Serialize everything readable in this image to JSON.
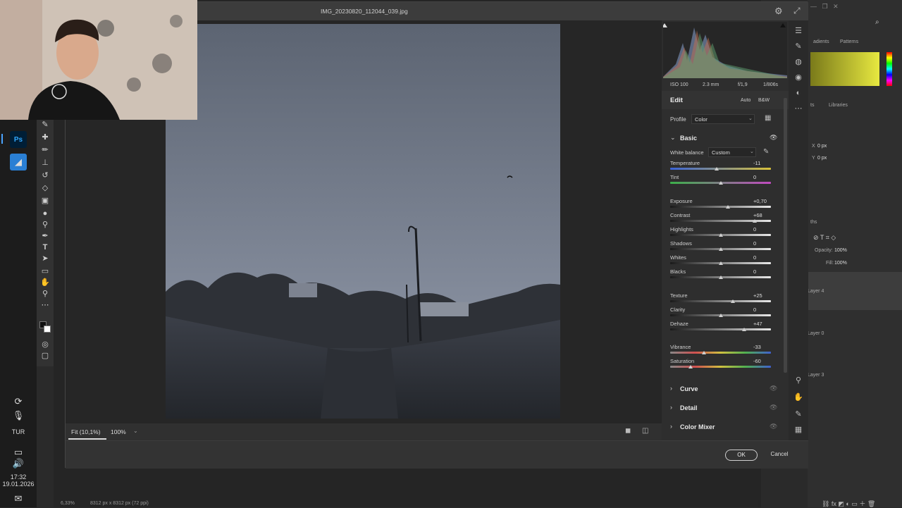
{
  "dialog": {
    "title": "IMG_20230820_112044_039.jpg",
    "exif": {
      "iso": "ISO 100",
      "focal": "2.3 mm",
      "aperture": "f/1,9",
      "shutter": "1/806s"
    },
    "edit": {
      "heading": "Edit",
      "auto": "Auto",
      "bw": "B&W"
    },
    "profile": {
      "label": "Profile",
      "value": "Color"
    },
    "basic": {
      "title": "Basic",
      "white_balance": {
        "label": "White balance",
        "value": "Custom"
      },
      "sliders": [
        {
          "label": "Temperature",
          "value": "-11",
          "pos": 0.46
        },
        {
          "label": "Tint",
          "value": "0",
          "pos": 0.5
        },
        {
          "label": "Exposure",
          "value": "+0,70",
          "pos": 0.57
        },
        {
          "label": "Contrast",
          "value": "+68",
          "pos": 0.84
        },
        {
          "label": "Highlights",
          "value": "0",
          "pos": 0.5
        },
        {
          "label": "Shadows",
          "value": "0",
          "pos": 0.5
        },
        {
          "label": "Whites",
          "value": "0",
          "pos": 0.5
        },
        {
          "label": "Blacks",
          "value": "0",
          "pos": 0.5
        },
        {
          "label": "Texture",
          "value": "+25",
          "pos": 0.625
        },
        {
          "label": "Clarity",
          "value": "0",
          "pos": 0.5
        },
        {
          "label": "Dehaze",
          "value": "+47",
          "pos": 0.735
        },
        {
          "label": "Vibrance",
          "value": "-33",
          "pos": 0.335
        },
        {
          "label": "Saturation",
          "value": "-60",
          "pos": 0.2
        }
      ]
    },
    "sections": [
      "Curve",
      "Detail",
      "Color Mixer"
    ],
    "zoom": {
      "fit": "Fit (10,1%)",
      "percent": "100%"
    },
    "ok": "OK",
    "cancel": "Cancel"
  },
  "ps": {
    "panel_tabs": {
      "gradients": "adients",
      "patterns": "Patterns",
      "libraries": "Libraries",
      "ts": "ts",
      "ths": "ths"
    },
    "props": {
      "x": "0 px",
      "y": "0 px"
    },
    "layers": {
      "opacity_label": "Opacity:",
      "opacity": "100%",
      "fill_label": "Fill:",
      "fill": "100%",
      "items": [
        "Layer 4",
        "Layer 0",
        "Layer 3"
      ]
    },
    "status": {
      "zoom": "6,33%",
      "size": "8312 px x 8312 px (72 ppi)"
    }
  },
  "taskbar": {
    "lang": "TUR",
    "time": "17:32",
    "date": "19.01.2026",
    "ps": "Ps"
  }
}
